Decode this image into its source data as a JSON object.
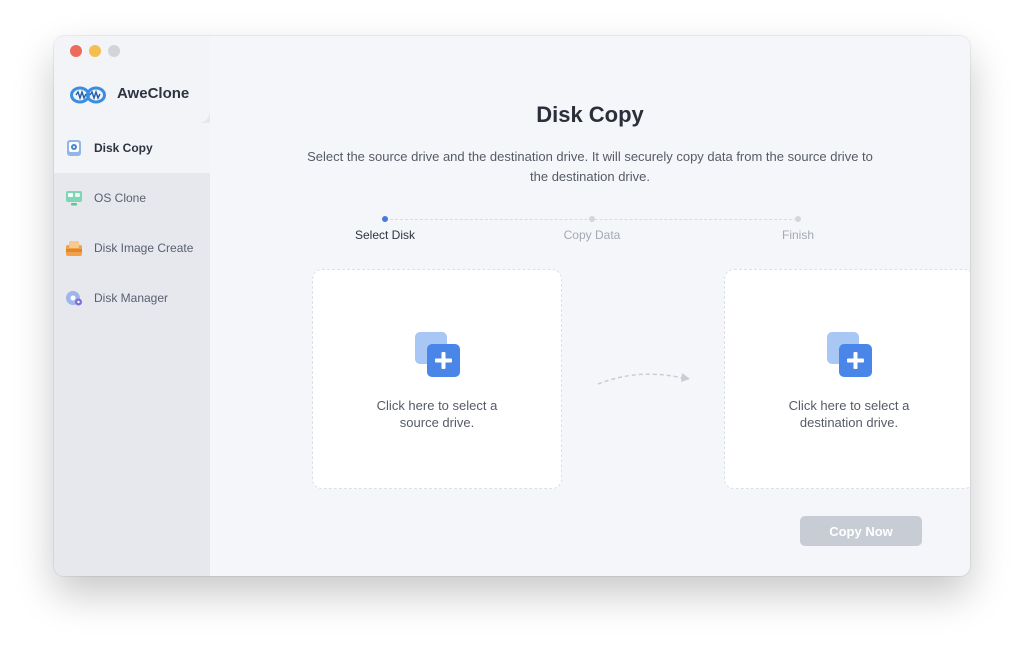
{
  "app": {
    "name": "AweClone"
  },
  "sidebar": {
    "items": [
      {
        "label": "Disk Copy",
        "icon": "disk-copy-icon"
      },
      {
        "label": "OS Clone",
        "icon": "os-clone-icon"
      },
      {
        "label": "Disk Image Create",
        "icon": "disk-image-icon"
      },
      {
        "label": "Disk Manager",
        "icon": "disk-manager-icon"
      }
    ]
  },
  "main": {
    "title": "Disk Copy",
    "subtitle": "Select the source drive and the destination drive. It will securely copy data from the source drive to the destination drive.",
    "steps": [
      {
        "label": "Select Disk",
        "active": true
      },
      {
        "label": "Copy Data",
        "active": false
      },
      {
        "label": "Finish",
        "active": false
      }
    ],
    "source": {
      "line1": "Click here to select a",
      "line2": "source drive."
    },
    "destination": {
      "line1": "Click here to select a",
      "line2": "destination drive."
    },
    "copy_button": "Copy Now"
  },
  "colors": {
    "accent": "#4a79d9",
    "button_disabled": "#c8ccd4",
    "sidebar": "#e6e8ee",
    "content": "#f5f6f9"
  }
}
